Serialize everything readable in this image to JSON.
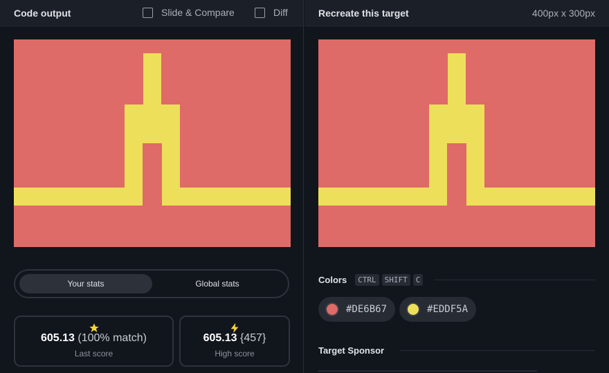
{
  "left_panel": {
    "title": "Code output",
    "options": [
      {
        "label": "Slide & Compare",
        "checked": false
      },
      {
        "label": "Diff",
        "checked": false
      }
    ]
  },
  "right_panel": {
    "title": "Recreate this target",
    "size": "400px x 300px"
  },
  "stats_toggle": {
    "active": "Your stats",
    "inactive": "Global stats"
  },
  "stats": {
    "last": {
      "value": "605.13",
      "detail": "(100% match)",
      "label": "Last score",
      "icon": "star-icon"
    },
    "high": {
      "value": "605.13",
      "detail": "{457}",
      "label": "High score",
      "icon": "lightning-icon"
    }
  },
  "colors_section": {
    "title": "Colors",
    "shortcut": [
      "CTRL",
      "SHIFT",
      "C"
    ],
    "swatches": [
      {
        "hex": "#DE6B67",
        "color": "#DE6B67"
      },
      {
        "hex": "#EDDF5A",
        "color": "#EDDF5A"
      }
    ]
  },
  "sponsor_section": {
    "title": "Target Sponsor"
  },
  "theme": {
    "background": "#DE6B67",
    "foreground": "#EDDF5A",
    "accent_yellow": "#F5D33A"
  }
}
